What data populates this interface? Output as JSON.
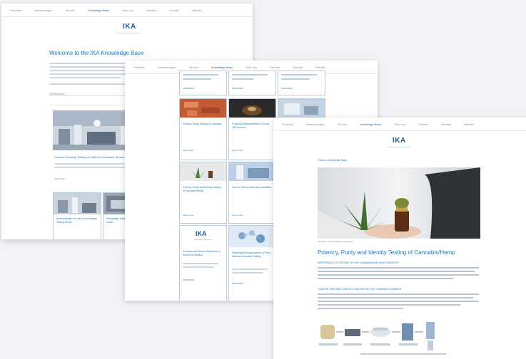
{
  "win1": {
    "nav": [
      "Produkte",
      "Anwendungen",
      "Service",
      "Knowledge Base",
      "Über uns",
      "Karriere",
      "Kontakt",
      "Händler"
    ],
    "logo": "IKA",
    "title": "Welcome to the IKA Knowledge Base",
    "card_title": "Content Cracking Testing on Different Cannabis Strains",
    "card_link": "Learn more",
    "sub_cards": [
      "Anwendungen im Labor und Analyse Testing Studie",
      "Knowledge Testing Studie Labor Guide"
    ]
  },
  "win2": {
    "nav": [
      "Produkte",
      "Anwendungen",
      "Service",
      "Knowledge Base",
      "Über uns",
      "Karriere",
      "Kontakt",
      "Händler"
    ],
    "logo": "IKA",
    "cards": [
      {
        "title": "Potency Purity Testing of Cannabis",
        "link": "Learn more"
      },
      {
        "title": "Cracking Measurements of Crude Oil Fractions",
        "link": "Learn more"
      },
      {
        "title": "Labor Testing Guide",
        "link": "Learn more"
      },
      {
        "title": "Potency Purity and Identity Testing of Cannabis/Hemp",
        "link": "Learn more"
      },
      {
        "title": "How to Train a Laboratory Assistant",
        "link": "Learn more"
      },
      {
        "title": "Professional Science Research of Solvent Extraction",
        "link": "Learn more"
      },
      {
        "title": "Sampling Homogenization of Plant Material Cannabis Testing",
        "link": "Learn more"
      }
    ]
  },
  "win3": {
    "nav": [
      "Produkte",
      "Anwendungen",
      "Service",
      "Knowledge Base",
      "Über uns",
      "Karriere",
      "Kontakt",
      "Händler"
    ],
    "logo": "IKA",
    "breadcrumb": "‹ Back to Knowledge Base",
    "caption": "Cannabis / Hemp Sample Preparation",
    "title": "Potency, Purity and Identity Testing of Cannabis/Hemp",
    "section1": "IMPORTANCE OF TESTING IN THE CANNABIS AND HEMP INDUSTRY",
    "section2": "CUSTOM TIME AND CONTROL AND WITHIN THE CANNABIS CHAMBER"
  },
  "colors": {
    "brand": "#1a5ba6",
    "link": "#1a79c4",
    "card_border": "#b8c9de"
  }
}
